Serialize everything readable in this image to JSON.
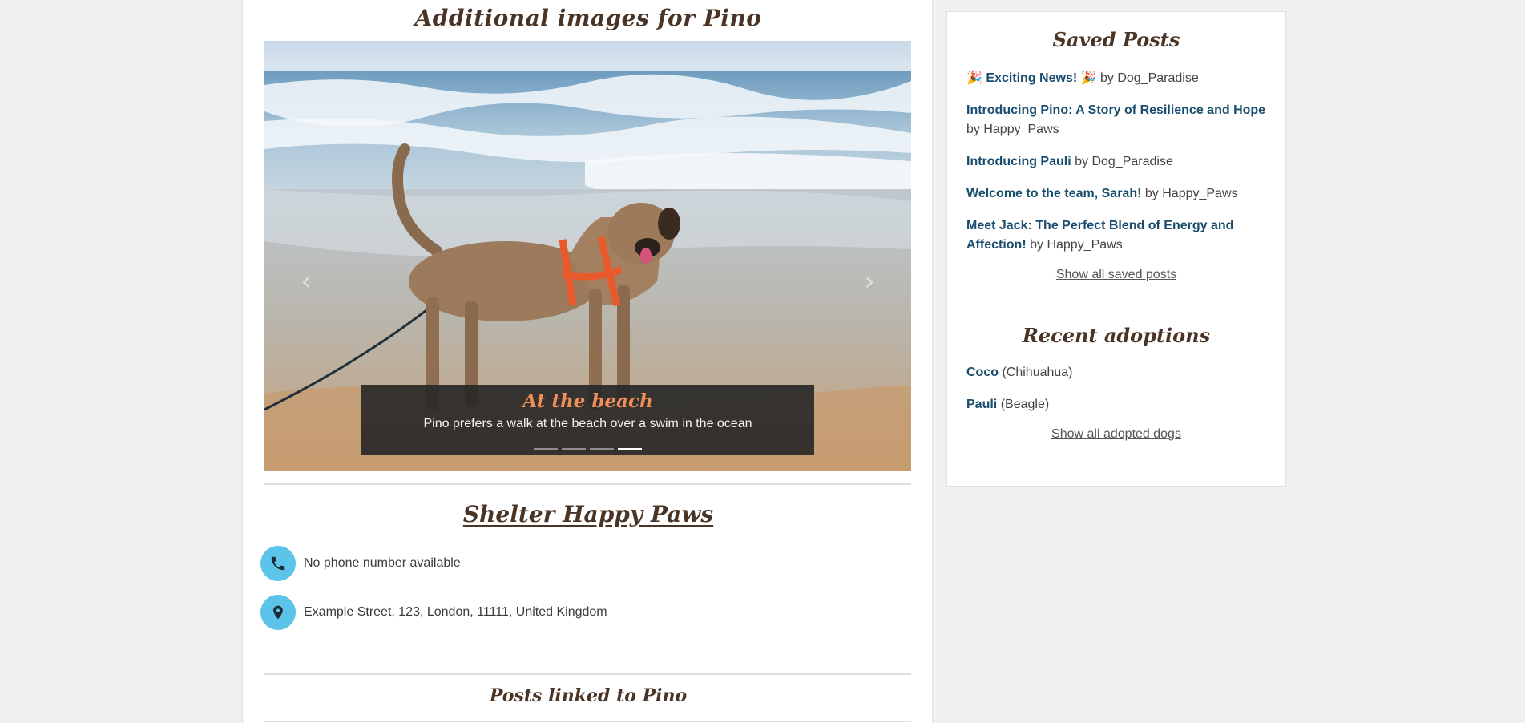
{
  "gallery": {
    "title": "Additional images for Pino",
    "prev_icon": "‹",
    "next_icon": "›",
    "slide": {
      "title": "At the beach",
      "text": "Pino prefers a walk at the beach over a swim in the ocean"
    },
    "indicator_count": 4,
    "active_indicator": 4
  },
  "shelter": {
    "name": "Shelter Happy Paws",
    "phone": "No phone number available",
    "address": "Example Street, 123, London, 11111, United Kingdom",
    "phone_icon": "phone-icon",
    "address_icon": "map-marker-icon"
  },
  "posts_linked": {
    "title": "Posts linked to Pino"
  },
  "sidebar": {
    "saved_title": "Saved Posts",
    "saved_posts": [
      {
        "title": "🎉 Exciting News! 🎉",
        "by": "by Dog_Paradise"
      },
      {
        "title": "Introducing Pino: A Story of Resilience and Hope",
        "by": "by Happy_Paws"
      },
      {
        "title": "Introducing Pauli",
        "by": "by Dog_Paradise"
      },
      {
        "title": "Welcome to the team, Sarah!",
        "by": "by Happy_Paws"
      },
      {
        "title": "Meet Jack: The Perfect Blend of Energy and Affection!",
        "by": "by Happy_Paws"
      }
    ],
    "show_all_saved": "Show all saved posts",
    "adoptions_title": "Recent adoptions",
    "adoptions": [
      {
        "name": "Coco",
        "breed": "(Chihuahua)"
      },
      {
        "name": "Pauli",
        "breed": "(Beagle)"
      }
    ],
    "show_all_adopted": "Show all adopted dogs"
  },
  "colors": {
    "heading": "#4a3426",
    "link": "#1a4d6e",
    "icon_circle": "#5bc4e8",
    "caption_title": "#f08f5a"
  }
}
